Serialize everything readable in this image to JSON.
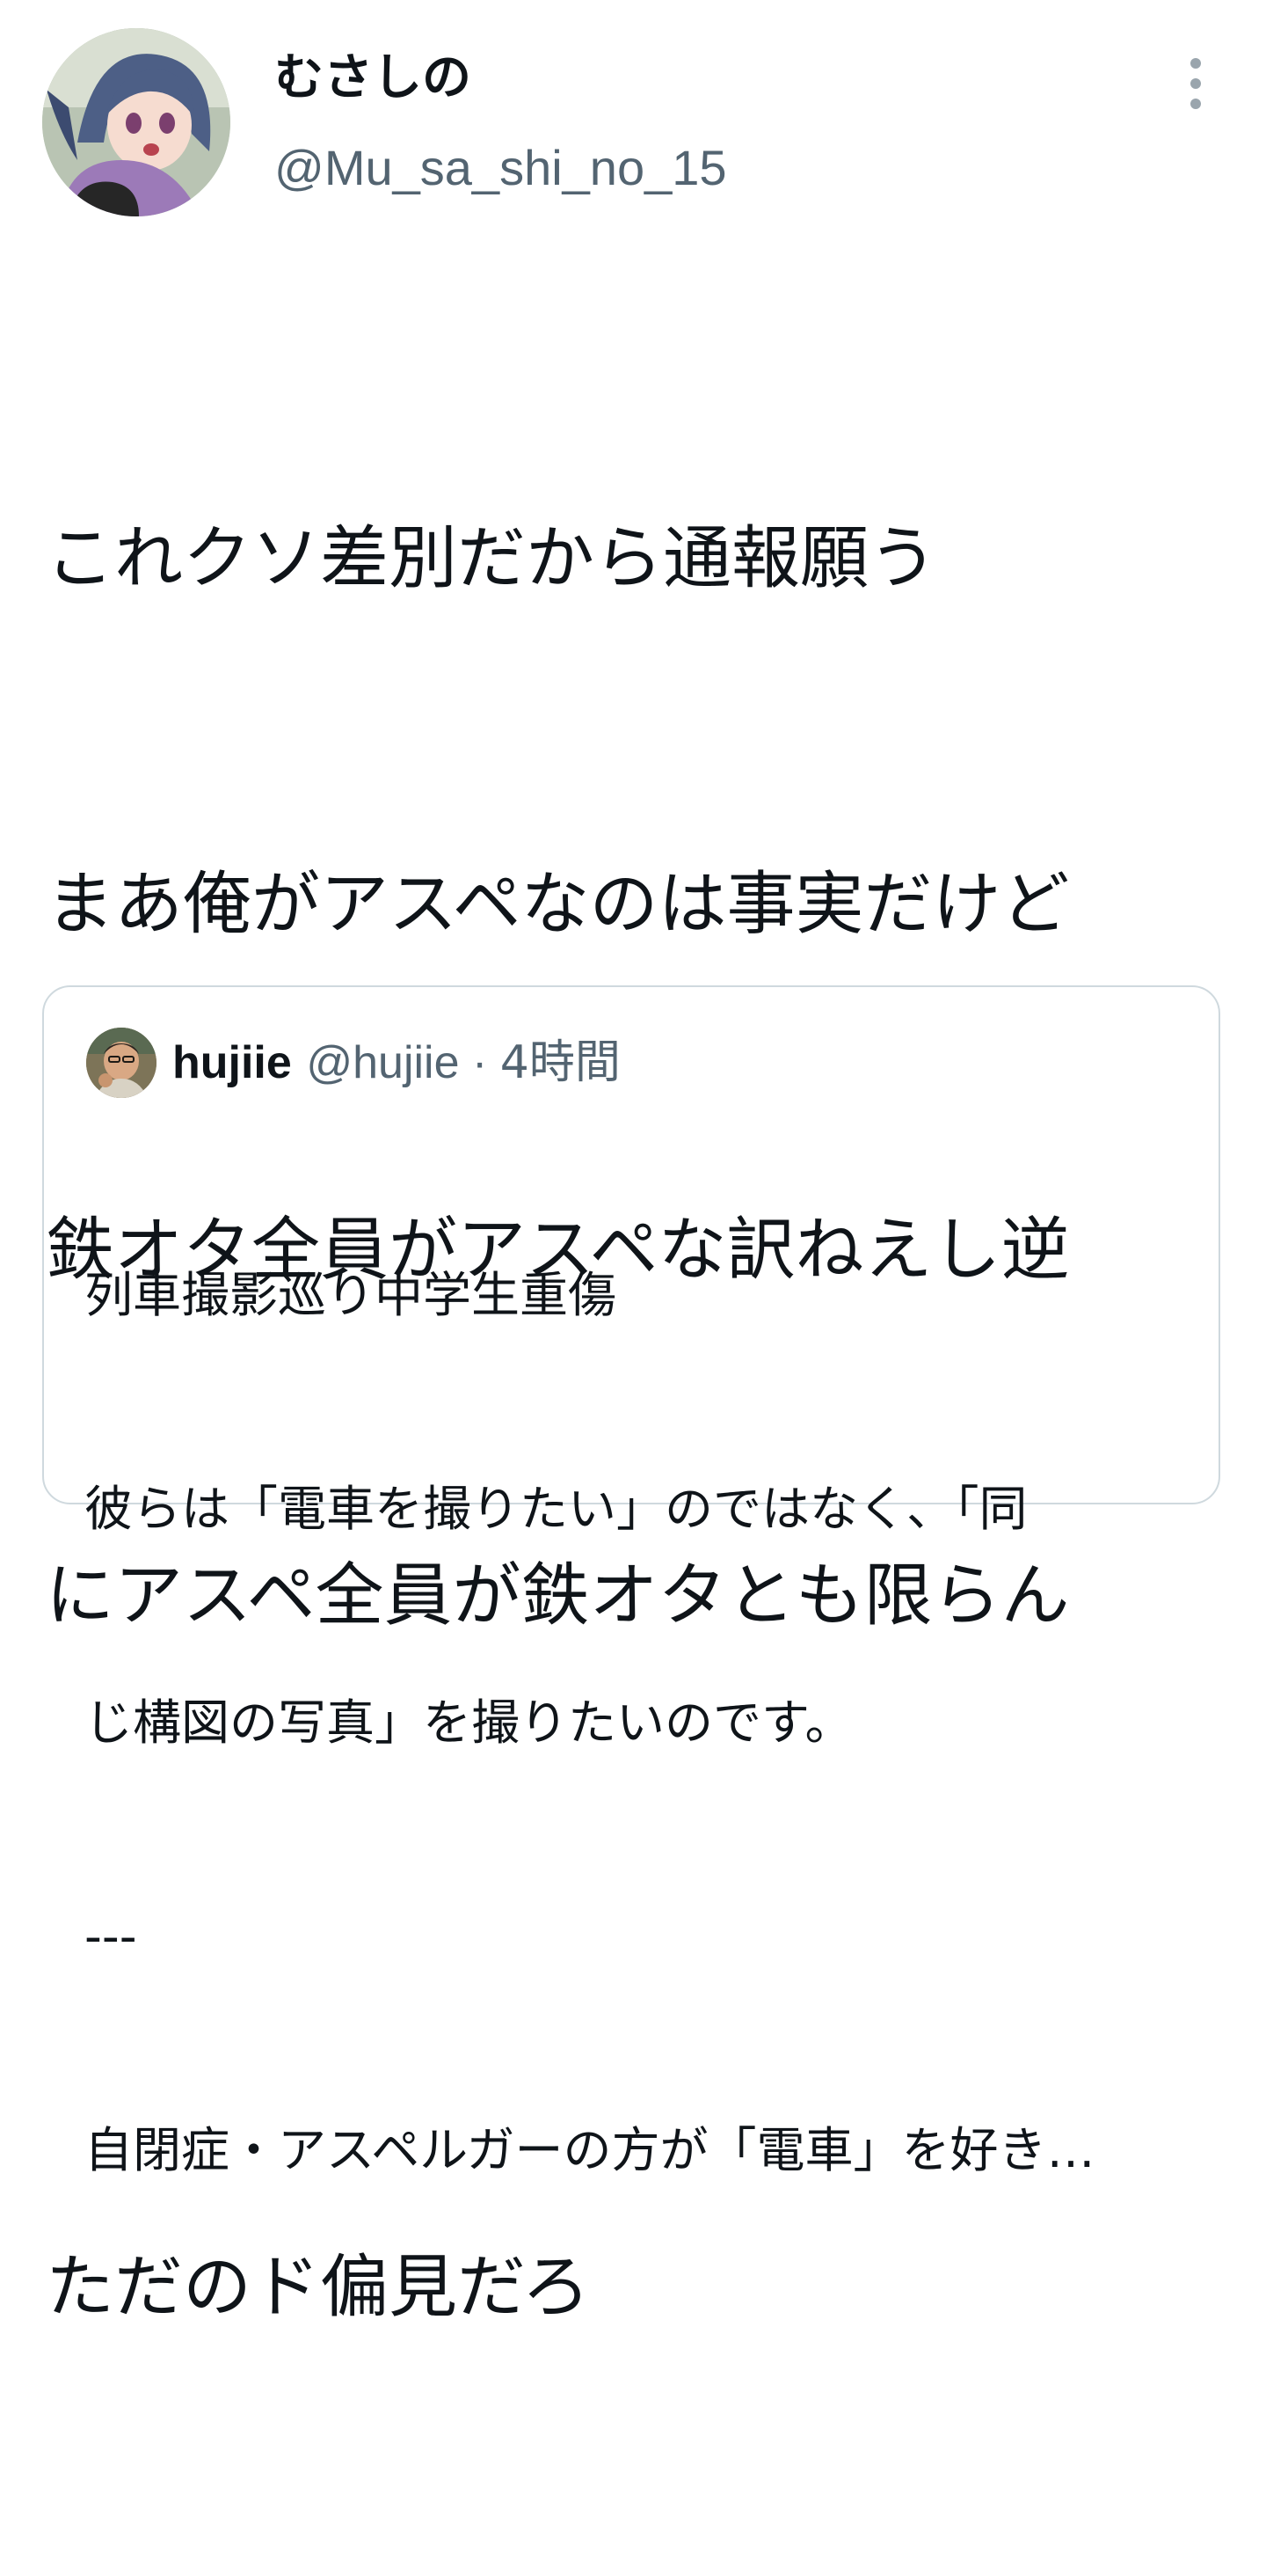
{
  "author": {
    "display_name": "むさしの",
    "handle": "@Mu_sa_shi_no_15",
    "avatar_icon": "anime-avatar-icon"
  },
  "more_icon": "more-vertical-icon",
  "tweet": {
    "lines": [
      "これクソ差別だから通報願う",
      "まあ俺がアスペなのは事実だけど",
      "鉄オタ全員がアスペな訳ねえし逆",
      "にアスペ全員が鉄オタとも限らん",
      "",
      "ただのド偏見だろ"
    ]
  },
  "quote": {
    "name": "hujiie",
    "handle": "@hujiie",
    "separator": " · ",
    "time": "4時間",
    "avatar_icon": "user-photo-avatar-icon",
    "lines": [
      "列車撮影巡り中学生重傷",
      "彼らは「電車を撮りたい」のではなく、「同",
      "じ構図の写真」を撮りたいのです。",
      "---",
      "自閉症・アスペルガーの方が「電車」を好き…"
    ]
  },
  "colors": {
    "text": "#0f1419",
    "secondary": "#536471",
    "border": "#cfd9de",
    "background": "#ffffff"
  }
}
